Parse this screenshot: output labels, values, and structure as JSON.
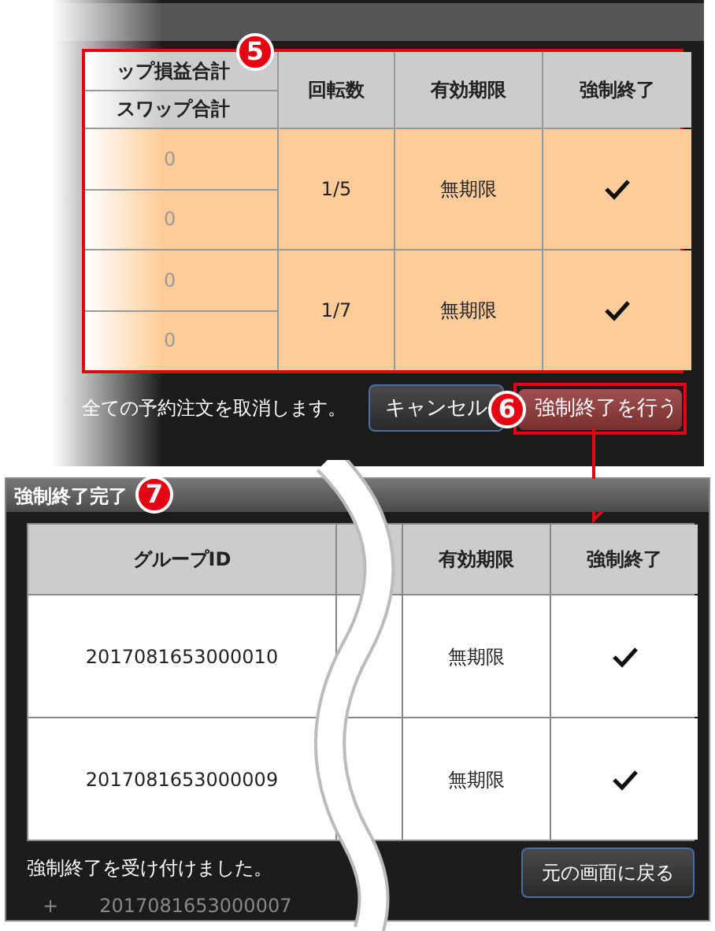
{
  "confirm_dialog": {
    "marker": "5",
    "table": {
      "column_1_lines": [
        "ップ損益合計",
        "スワップ合計"
      ],
      "columns": [
        "回転数",
        "有効期限",
        "強制終了"
      ],
      "rows": [
        {
          "column_1": [
            "0",
            "0"
          ],
          "turns": "1/5",
          "expiry": "無期限",
          "force_close": true
        },
        {
          "column_1": [
            "0",
            "0"
          ],
          "turns": "1/7",
          "expiry": "無期限",
          "force_close": true
        }
      ]
    },
    "message": "全ての予約注文を取消します。",
    "cancel_button": "キャンセル",
    "execute_button": "強制終了を行う",
    "execute_marker": "6"
  },
  "complete_dialog": {
    "title": "強制終了完了",
    "marker": "7",
    "table": {
      "columns": [
        "グループID",
        "有効期限",
        "強制終了"
      ],
      "rows": [
        {
          "group_id": "2017081653000010",
          "expiry": "無期限",
          "force_close": true
        },
        {
          "group_id": "2017081653000009",
          "expiry": "無期限",
          "force_close": true
        }
      ]
    },
    "message": "強制終了を受け付けました。",
    "back_button": "元の画面に戻る",
    "background_row": {
      "expand": "+",
      "group_id": "2017081653000007"
    }
  }
}
